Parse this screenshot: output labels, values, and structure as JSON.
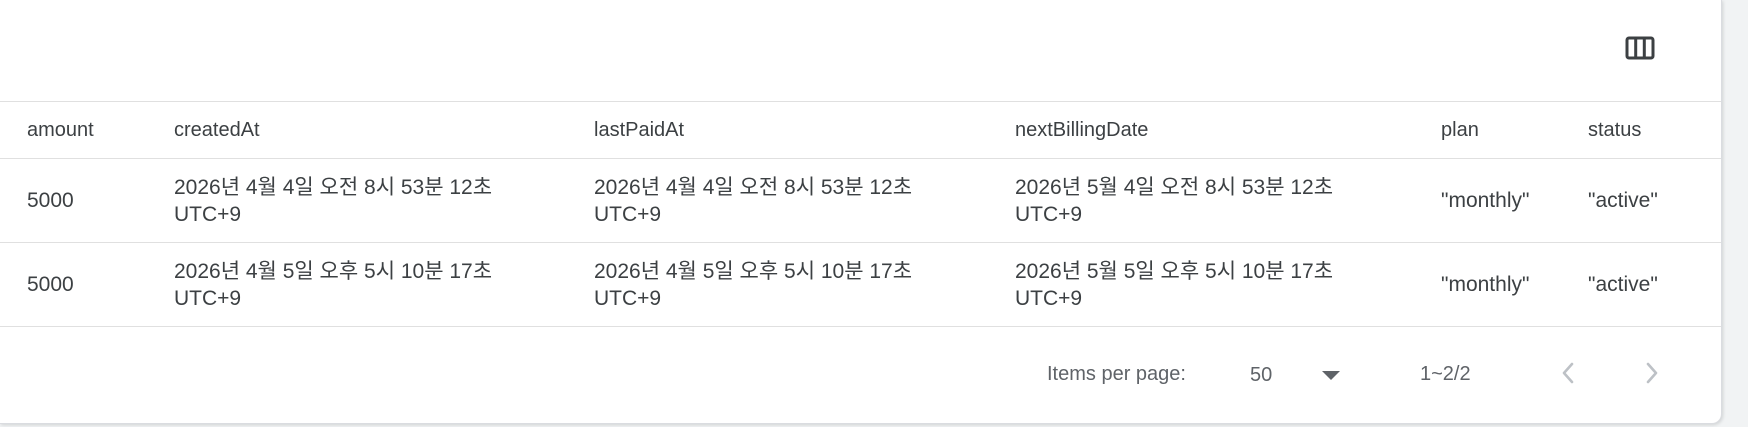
{
  "toolbar": {
    "columns_icon": "view-column-icon"
  },
  "table": {
    "headers": {
      "amount": "amount",
      "createdAt": "createdAt",
      "lastPaidAt": "lastPaidAt",
      "nextBillingDate": "nextBillingDate",
      "plan": "plan",
      "status": "status"
    },
    "rows": [
      {
        "amount": "5000",
        "createdAt": {
          "line1": "2026년 4월 4일 오전 8시 53분 12초",
          "line2": "UTC+9"
        },
        "lastPaidAt": {
          "line1": "2026년 4월 4일 오전 8시 53분 12초",
          "line2": "UTC+9"
        },
        "nextBillingDate": {
          "line1": "2026년 5월 4일 오전 8시 53분 12초",
          "line2": "UTC+9"
        },
        "plan": "\"monthly\"",
        "status": "\"active\""
      },
      {
        "amount": "5000",
        "createdAt": {
          "line1": "2026년 4월 5일 오후 5시 10분 17초",
          "line2": "UTC+9"
        },
        "lastPaidAt": {
          "line1": "2026년 4월 5일 오후 5시 10분 17초",
          "line2": "UTC+9"
        },
        "nextBillingDate": {
          "line1": "2026년 5월 5일 오후 5시 10분 17초",
          "line2": "UTC+9"
        },
        "plan": "\"monthly\"",
        "status": "\"active\""
      }
    ]
  },
  "pagination": {
    "items_per_page_label": "Items per page:",
    "items_per_page_value": "50",
    "range_label": "1~2/2",
    "prev_icon": "chevron-left-icon",
    "next_icon": "chevron-right-icon"
  },
  "colors": {
    "text": "#3c4043",
    "muted": "#5f6368",
    "divider": "#e0e0e0",
    "disabled_icon": "#bdc1c6"
  }
}
